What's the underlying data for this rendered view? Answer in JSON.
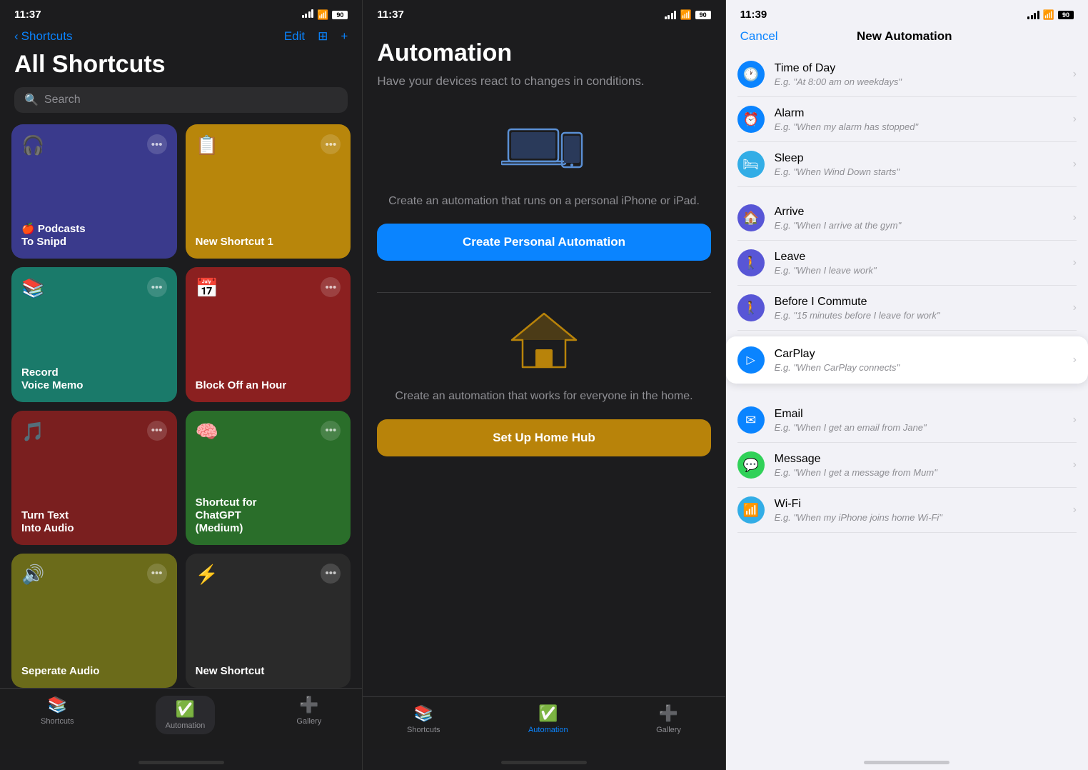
{
  "screen1": {
    "status": {
      "time": "11:37",
      "location": "▲",
      "battery": "90"
    },
    "nav": {
      "back_label": "Shortcuts",
      "edit_label": "Edit",
      "add_label": "+"
    },
    "title": "All Shortcuts",
    "search_placeholder": "Search",
    "shortcuts": [
      {
        "id": "s1",
        "icon": "🎧",
        "label": "Podcasts\nTo Snipd",
        "color": "card-indigo"
      },
      {
        "id": "s2",
        "icon": "📋",
        "label": "New Shortcut 1",
        "color": "card-gold"
      },
      {
        "id": "s3",
        "icon": "📚",
        "label": "Record\nVoice Memo",
        "color": "card-teal"
      },
      {
        "id": "s4",
        "icon": "📅",
        "label": "Block Off an Hour",
        "color": "card-red"
      },
      {
        "id": "s5",
        "icon": "🎵",
        "label": "Turn Text\nInto Audio",
        "color": "card-darkred"
      },
      {
        "id": "s6",
        "icon": "🧠",
        "label": "Shortcut for\nChatGPT\n(Medium)",
        "color": "card-green"
      },
      {
        "id": "s7",
        "icon": "🔊",
        "label": "Seperate Audio",
        "color": "card-olive"
      },
      {
        "id": "s8",
        "icon": "⚡",
        "label": "New Shortcut",
        "color": "card-dark"
      }
    ],
    "tabs": [
      {
        "id": "t1",
        "icon": "📚",
        "label": "Shortcuts",
        "active": false
      },
      {
        "id": "t2",
        "icon": "✅",
        "label": "Automation",
        "active": true
      },
      {
        "id": "t3",
        "icon": "➕",
        "label": "Gallery",
        "active": false
      }
    ]
  },
  "screen2": {
    "status": {
      "time": "11:37",
      "battery": "90"
    },
    "title": "Automation",
    "subtitle": "Have your devices react to changes in conditions.",
    "personal_desc": "Create an automation that runs on a personal iPhone or iPad.",
    "personal_btn": "Create Personal Automation",
    "home_desc": "Create an automation that works for everyone in the home.",
    "home_btn": "Set Up Home Hub",
    "tabs": [
      {
        "id": "t1",
        "icon": "📚",
        "label": "Shortcuts",
        "active": false
      },
      {
        "id": "t2",
        "icon": "✅",
        "label": "Automation",
        "active": true
      },
      {
        "id": "t3",
        "icon": "➕",
        "label": "Gallery",
        "active": false
      }
    ]
  },
  "screen3": {
    "status": {
      "time": "11:39",
      "battery": "90"
    },
    "nav": {
      "cancel_label": "Cancel",
      "title": "New Automation"
    },
    "items": [
      {
        "id": "a1",
        "icon": "🕐",
        "icon_color": "auto-icon-blue",
        "title": "Time of Day",
        "subtitle": "E.g. \"At 8:00 am on weekdays\""
      },
      {
        "id": "a2",
        "icon": "⏰",
        "icon_color": "auto-icon-blue",
        "title": "Alarm",
        "subtitle": "E.g. \"When my alarm has stopped\""
      },
      {
        "id": "a3",
        "icon": "🛏",
        "icon_color": "auto-icon-teal",
        "title": "Sleep",
        "subtitle": "E.g. \"When Wind Down starts\""
      },
      {
        "id": "a4",
        "icon": "🏠",
        "icon_color": "auto-icon-house",
        "title": "Arrive",
        "subtitle": "E.g. \"When I arrive at the gym\""
      },
      {
        "id": "a5",
        "icon": "🚶",
        "icon_color": "auto-icon-house",
        "title": "Leave",
        "subtitle": "E.g. \"When I leave work\""
      },
      {
        "id": "a6",
        "icon": "🚶",
        "icon_color": "auto-icon-house",
        "title": "Before I Commute",
        "subtitle": "E.g. \"15 minutes before I leave for work\""
      },
      {
        "id": "a7",
        "icon": "▷",
        "icon_color": "auto-icon-carplay",
        "title": "CarPlay",
        "subtitle": "E.g. \"When CarPlay connects\"",
        "highlighted": true
      },
      {
        "id": "a8",
        "icon": "✉",
        "icon_color": "auto-icon-mail",
        "title": "Email",
        "subtitle": "E.g. \"When I get an email from Jane\""
      },
      {
        "id": "a9",
        "icon": "💬",
        "icon_color": "auto-icon-message",
        "title": "Message",
        "subtitle": "E.g. \"When I get a message from Mum\""
      },
      {
        "id": "a10",
        "icon": "📶",
        "icon_color": "auto-icon-wifi",
        "title": "Wi-Fi",
        "subtitle": "E.g. \"When my iPhone joins home Wi-Fi\""
      }
    ]
  }
}
